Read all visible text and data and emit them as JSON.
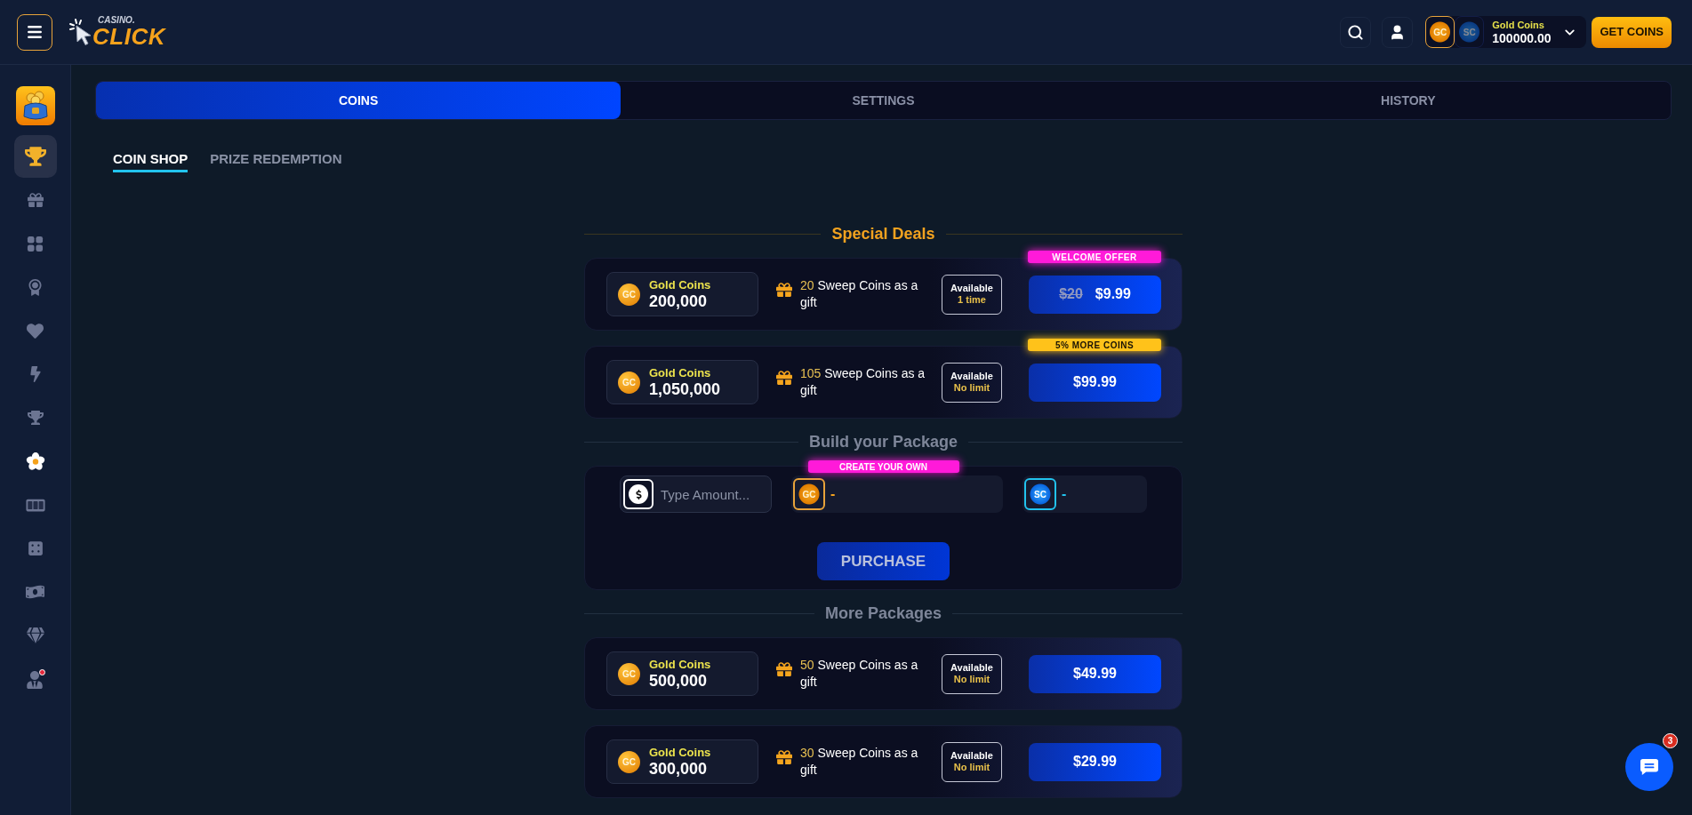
{
  "header": {
    "logo": {
      "top": "CASINO.",
      "main": "CLICK"
    },
    "balance": {
      "currencies": [
        {
          "code": "GC",
          "kind": "gold",
          "selected": true
        },
        {
          "code": "SC",
          "kind": "sweep",
          "selected": false
        }
      ],
      "label": "Gold Coins",
      "amount": "100000.00"
    },
    "cta": "GET COINS"
  },
  "sidebar": {
    "items": [
      {
        "selected": false
      },
      {
        "selected": true
      },
      {
        "selected": false
      },
      {
        "selected": false
      },
      {
        "selected": false
      },
      {
        "selected": false
      },
      {
        "selected": false
      },
      {
        "selected": false
      },
      {
        "selected": false
      },
      {
        "selected": false
      },
      {
        "selected": false
      },
      {
        "selected": false
      },
      {
        "selected": false
      },
      {
        "selected": false
      }
    ]
  },
  "tabs": [
    {
      "label": "COINS",
      "selected": true
    },
    {
      "label": "SETTINGS",
      "selected": false
    },
    {
      "label": "HISTORY",
      "selected": false
    }
  ],
  "subtabs": [
    {
      "label": "COIN SHOP",
      "selected": true
    },
    {
      "label": "PRIZE REDEMPTION",
      "selected": false
    }
  ],
  "sections": [
    {
      "kind": "special",
      "title": "Special Deals",
      "packages": [
        {
          "coin": "GC",
          "coin_label": "Gold Coins",
          "amount": "200,000",
          "gift_count": "20",
          "gift_text": "Sweep Coins as a gift",
          "availability_label": "Available",
          "availability": "1 time",
          "old_price": "$20",
          "price": "$9.99",
          "badge": {
            "text": "WELCOME OFFER",
            "color": "#ff1ad9"
          }
        },
        {
          "coin": "GC",
          "coin_label": "Gold Coins",
          "amount": "1,050,000",
          "gift_count": "105",
          "gift_text": "Sweep Coins as a gift",
          "availability_label": "Available",
          "availability": "No limit",
          "price": "$99.99",
          "badge": {
            "text": "5% MORE COINS",
            "color": "#ffc21a"
          }
        }
      ]
    },
    {
      "kind": "builder",
      "title": "Build your Package",
      "badge": "CREATE YOUR OWN",
      "amount_field": {
        "placeholder": "Type Amount..."
      },
      "outputs": [
        {
          "code": "GC",
          "kind": "gold",
          "value": "-"
        },
        {
          "code": "SC",
          "kind": "sweep",
          "value": "-"
        }
      ],
      "button": "PURCHASE"
    },
    {
      "kind": "regular",
      "title": "More Packages",
      "packages": [
        {
          "coin": "GC",
          "coin_label": "Gold Coins",
          "amount": "500,000",
          "gift_count": "50",
          "gift_text": "Sweep Coins as a gift",
          "availability_label": "Available",
          "availability": "No limit",
          "price": "$49.99"
        },
        {
          "coin": "GC",
          "coin_label": "Gold Coins",
          "amount": "300,000",
          "gift_count": "30",
          "gift_text": "Sweep Coins as a gift",
          "availability_label": "Available",
          "availability": "No limit",
          "price": "$29.99"
        }
      ]
    }
  ],
  "chat": {
    "badge": "3"
  }
}
